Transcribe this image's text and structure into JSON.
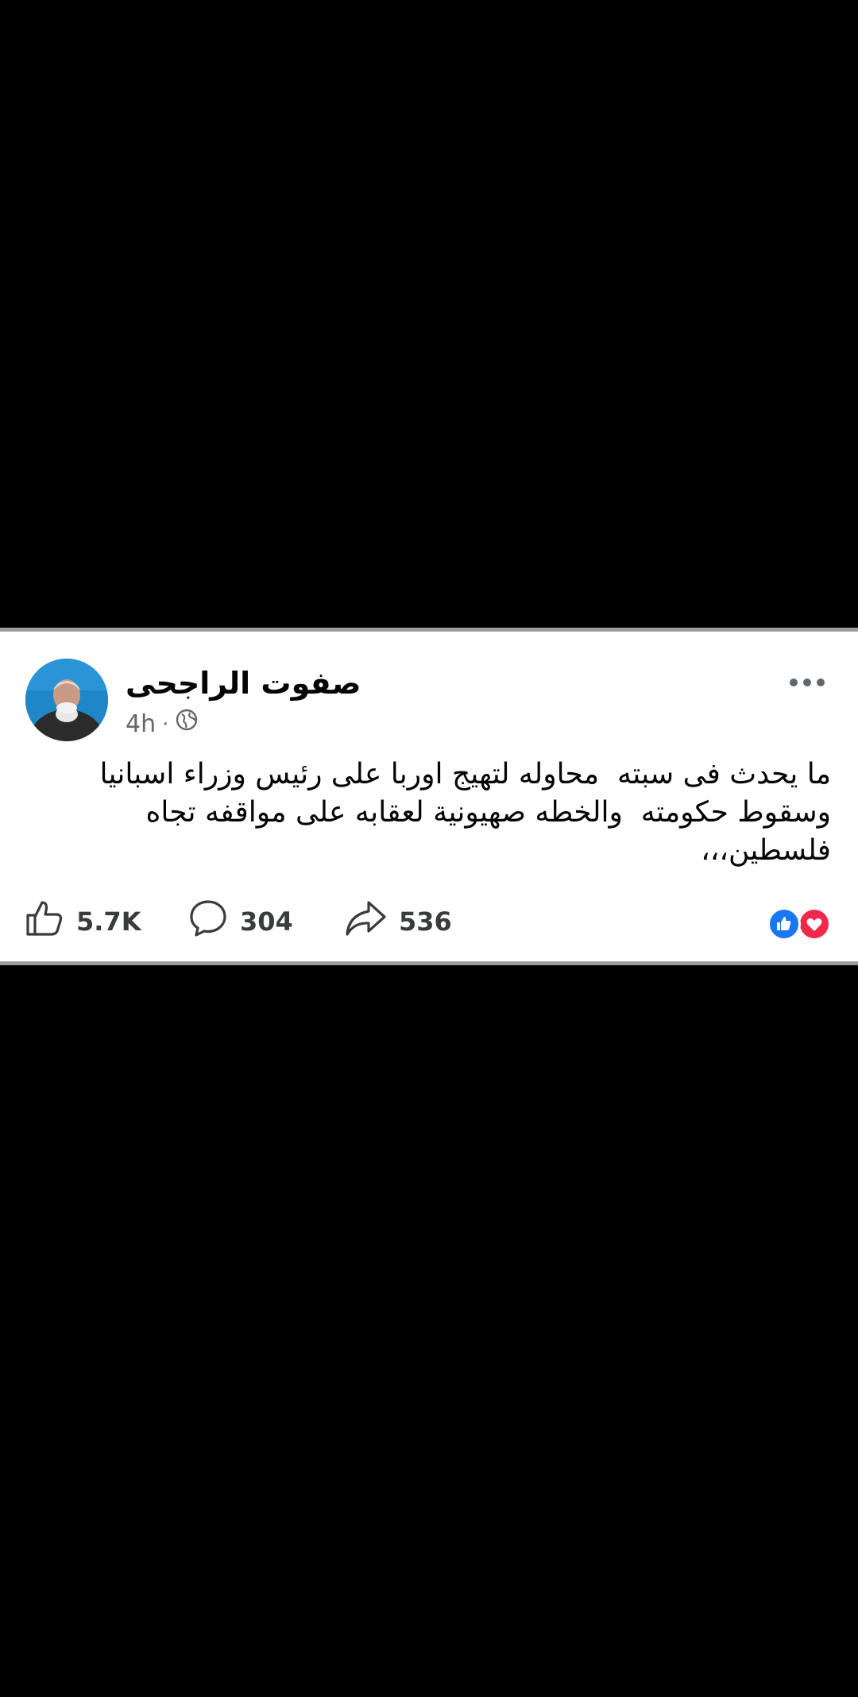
{
  "post": {
    "author_name": "صفوت الراجحى",
    "time": "4h",
    "separator": "·",
    "privacy_icon": "globe-icon",
    "text": "ما يحدث فى سبته  محاوله لتهيج اوربا على رئيس وزراء اسبانيا وسقوط حكومته  والخطه صهيونية لعقابه على مواقفه تجاه فلسطين،،،",
    "more_icon": "more-options-icon"
  },
  "actions": {
    "likes": "5.7K",
    "comments": "304",
    "shares": "536",
    "like_icon": "thumbs-up-icon",
    "comment_icon": "comment-icon",
    "share_icon": "share-icon"
  },
  "reactions": [
    "like",
    "love"
  ],
  "colors": {
    "background": "#000000",
    "card": "#ffffff",
    "like_blue": "#1877f2",
    "love_red": "#f02849",
    "secondary_text": "#65676b"
  }
}
